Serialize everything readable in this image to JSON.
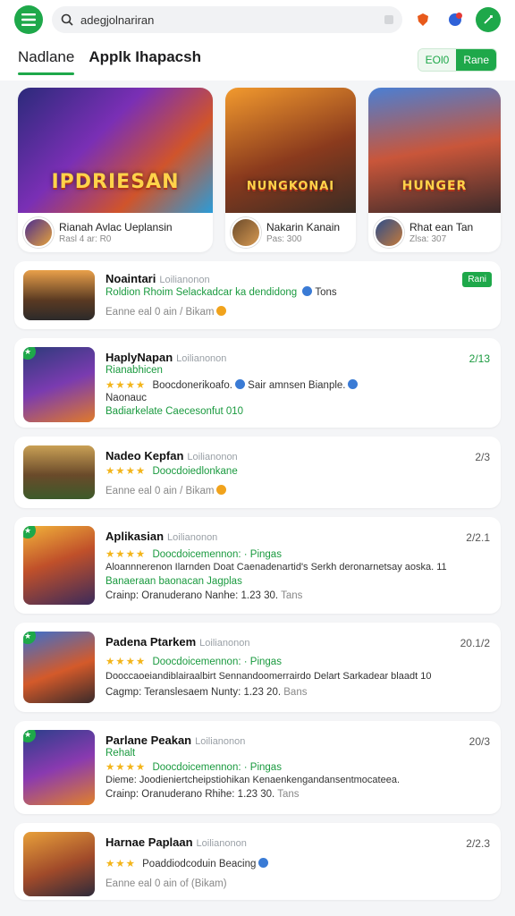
{
  "search": {
    "value": "adegjolnariran"
  },
  "tabs": [
    {
      "label": "Nadlane"
    },
    {
      "label": "Applk Ihapacsh"
    }
  ],
  "toggle": {
    "off_label": "ЕOl0",
    "on_label": "Rane"
  },
  "featured": [
    {
      "logo": "IPDRIESAN",
      "name": "Rianah Avlac Ueplansin",
      "sub": "Rasl 4 ar: R0"
    },
    {
      "logo": "NUNGKONAI",
      "name": "Nakarin Kanain",
      "sub": "Pas: 300"
    },
    {
      "logo": "HUNGER",
      "name": "Rhat ean Tan",
      "sub": "Zlsa: 307"
    }
  ],
  "rows": [
    {
      "title": "Noaintari",
      "tag": "Loilianonon",
      "line1": "Roldion Rhoim Selackadcar ka dendidong",
      "line1_tail": "Tons",
      "line2": "Eanne eal 0 ain / Bikam",
      "badge": "Rani"
    },
    {
      "title": "HaplyNapan",
      "tag": "Loilianonon",
      "rank": "2/13",
      "line1": "Rianabhicen",
      "line2": "Boocdonerikoafo.",
      "line2_tail": "Sair amnsen Bianple.",
      "line3": "Naonauc",
      "line4": "Badiarkelate Caecesonfut 010"
    },
    {
      "title": "Nadeo Kepfan",
      "tag": "Loilianonon",
      "rank": "2/3",
      "line1": "Doocdoiedlonkane",
      "line2": "Eanne eal 0 ain / Bikam"
    },
    {
      "title": "Aplikasian",
      "tag": "Loilianonon",
      "rank": "2/2.1",
      "line1": "Doocdoicemennon:",
      "line1_tail": "Pingas",
      "line2": "Aloannnerenon Ilarnden Doat Caenadenartid's Serkh deronarnetsay aoska. 11",
      "line3": "Banaeraan baonacan Jagplas",
      "line4": "Crainp: Oranuderano Nanhe: 1.23 30.",
      "line4_tail": "Tans"
    },
    {
      "title": "Padena Ptarkem",
      "tag": "Loilianonon",
      "rank": "20.1/2",
      "line1": "Doocdoicemennon:",
      "line1_tail": "Pingas",
      "line2": "Dooccaoeiandiblairaalbirt Sennandoomerrairdo Delart Sarkadear blaadt 10",
      "line3": "Cagmp: Teranslesaem Nunty: 1.23 20.",
      "line3_tail": "Bans"
    },
    {
      "title": "Parlane Peakan",
      "tag": "Loilianonon",
      "rank": "20/3",
      "line1": "Rehalt",
      "line2": "Doocdoicemennon:",
      "line2_tail": "Pingas",
      "line3": "Dieme: Joodieniertcheipstiohikan Kenaenkengandansentmocateea.",
      "line4": "Crainp: Oranuderano Rhihe: 1.23 30.",
      "line4_tail": "Tans"
    },
    {
      "title": "Harnae Paplaan",
      "tag": "Loilianonon",
      "rank": "2/2.3",
      "line1": "Poaddiodcoduin Beacing",
      "line2": "Eanne eal 0 ain of (Bikam)"
    }
  ],
  "colors": {
    "accent": "#1ea84a",
    "star": "#f3b51b",
    "info": "#3a7bd5"
  }
}
